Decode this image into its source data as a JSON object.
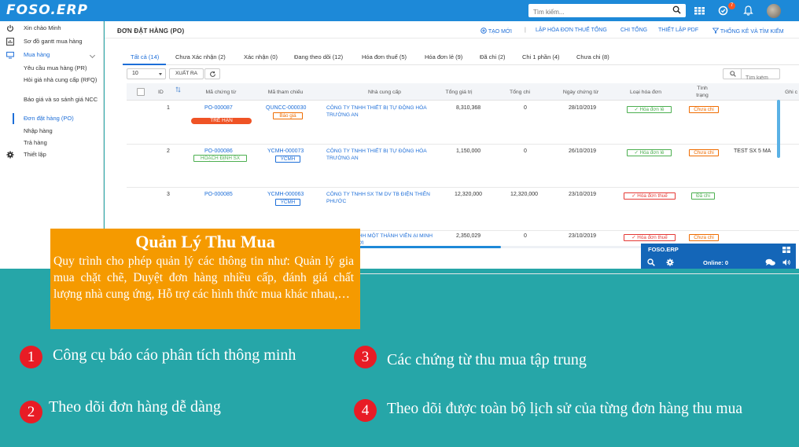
{
  "topbar": {
    "logo": "FOSO.ERP",
    "search_placeholder": "Tìm kiếm...",
    "notification_count": "7",
    "icons": [
      "search-icon",
      "apps-grid-icon",
      "notification-icon",
      "bell-icon",
      "avatar"
    ]
  },
  "sidebar": {
    "greeting": "Xin chào Minh",
    "items": [
      {
        "label": "Sơ đồ gantt mua hàng",
        "icon": "chart-icon"
      },
      {
        "label": "Mua hàng",
        "icon": "monitor-icon"
      }
    ],
    "submenu": [
      "Yêu cầu mua hàng (PR)",
      "Hỏi giá nhà cung cấp (RFQ)",
      "Báo giá và so sánh giá NCC",
      "Đơn đặt hàng (PO)",
      "Nhập hàng",
      "Trả hàng"
    ],
    "settings": "Thiết lập",
    "active_color": "#1d6ed8"
  },
  "main": {
    "title": "ĐƠN ĐẶT HÀNG (PO)",
    "actions": {
      "create": "TẠO MỚI",
      "separator": "|",
      "tax_invoice": "LẬP HÓA ĐƠN THUẾ TỔNG",
      "total_expense": "CHI TỔNG",
      "pdf": "THIẾT LẬP PDF",
      "stats": "THỐNG KÊ VÀ TÌM KIẾM"
    },
    "tabs": [
      "Tất cả (14)",
      "Chưa Xác nhận (2)",
      "Xác nhận (0)",
      "Đang theo dõi (12)",
      "Hóa đơn thuế (5)",
      "Hóa đơn lẻ (9)",
      "Đã chi (2)",
      "Chi 1 phần (4)",
      "Chưa chi (8)"
    ],
    "page_size": "10",
    "export": "XUẤT RA",
    "table_search_placeholder": "Tìm kiếm",
    "columns": [
      "ID",
      "Mã chứng từ",
      "Mã tham chiếu",
      "Nhà cung cấp",
      "Tổng giá trị",
      "Tổng chi",
      "Ngày chứng từ",
      "Loại hóa đơn",
      "Tình trạng",
      "Ghi c"
    ],
    "rows": [
      {
        "id": "1",
        "code": "PO-000087",
        "code_tag": "TRỄ HẠN",
        "ref": "QUNCC-000030",
        "ref_tag": "Báo giá",
        "supplier": "CÔNG TY TNHH THIẾT BỊ TỰ ĐỘNG HÓA TRƯỜNG AN",
        "total": "8,310,368",
        "paid": "0",
        "date": "28/10/2019",
        "invoice": "✓ Hóa đơn lẻ",
        "status": "Chưa chi",
        "note": ""
      },
      {
        "id": "2",
        "code": "PO-000086",
        "code_tag": "HOẠCH ĐỊNH SX",
        "ref": "YCMH-000073",
        "ref_tag": "YCMH",
        "supplier": "CÔNG TY TNHH THIẾT BỊ TỰ ĐỘNG HÓA TRƯỜNG AN",
        "total": "1,150,000",
        "paid": "0",
        "date": "26/10/2019",
        "invoice": "✓ Hóa đơn lẻ",
        "status": "Chưa chi",
        "note": "TEST SX 5 MA"
      },
      {
        "id": "3",
        "code": "PO-000085",
        "code_tag": "",
        "ref": "YCMH-000063",
        "ref_tag": "YCMH",
        "supplier": "CÔNG TY TNHH SX TM DV TB ĐIỆN THIÊN PHƯỚC",
        "total": "12,320,000",
        "paid": "12,320,000",
        "date": "23/10/2019",
        "invoice": "✓ Hóa đơn thuế",
        "status": "Đã chi",
        "note": ""
      },
      {
        "id": "",
        "code": "",
        "code_tag": "",
        "ref": "",
        "ref_tag": "",
        "supplier": "NHH MỘT THÀNH VIÊN ẠI MINH TỚI",
        "total": "2,350,029",
        "paid": "0",
        "date": "23/10/2019",
        "invoice": "✓ Hóa đơn thuế",
        "status": "Chưa chi",
        "note": ""
      }
    ]
  },
  "chat": {
    "title": "FOSO.ERP",
    "online": "Online: 0"
  },
  "info_box": {
    "heading": "Quản Lý Thu Mua",
    "body": "Quy trình cho phép quản lý các thông tin như: Quản lý gia mua chặt chẽ, Duyệt đơn hàng nhiều cấp, đánh giá chất lượng nhà cung ứng, Hỗ trợ các hình thức mua khác nhau,…"
  },
  "features": [
    {
      "num": "1",
      "text": "Công cụ báo cáo phân tích thông minh"
    },
    {
      "num": "2",
      "text": "Theo dõi đơn hàng dễ dàng"
    },
    {
      "num": "3",
      "text": "Các chứng từ thu mua tập trung"
    },
    {
      "num": "4",
      "text": "Theo dõi được toàn bộ lịch sử của từng đơn hàng thu mua"
    }
  ],
  "colors": {
    "topbar": "#1d89d8",
    "background": "#26a6a8",
    "info_box": "#f59a00",
    "number_badge": "#e81c25"
  }
}
